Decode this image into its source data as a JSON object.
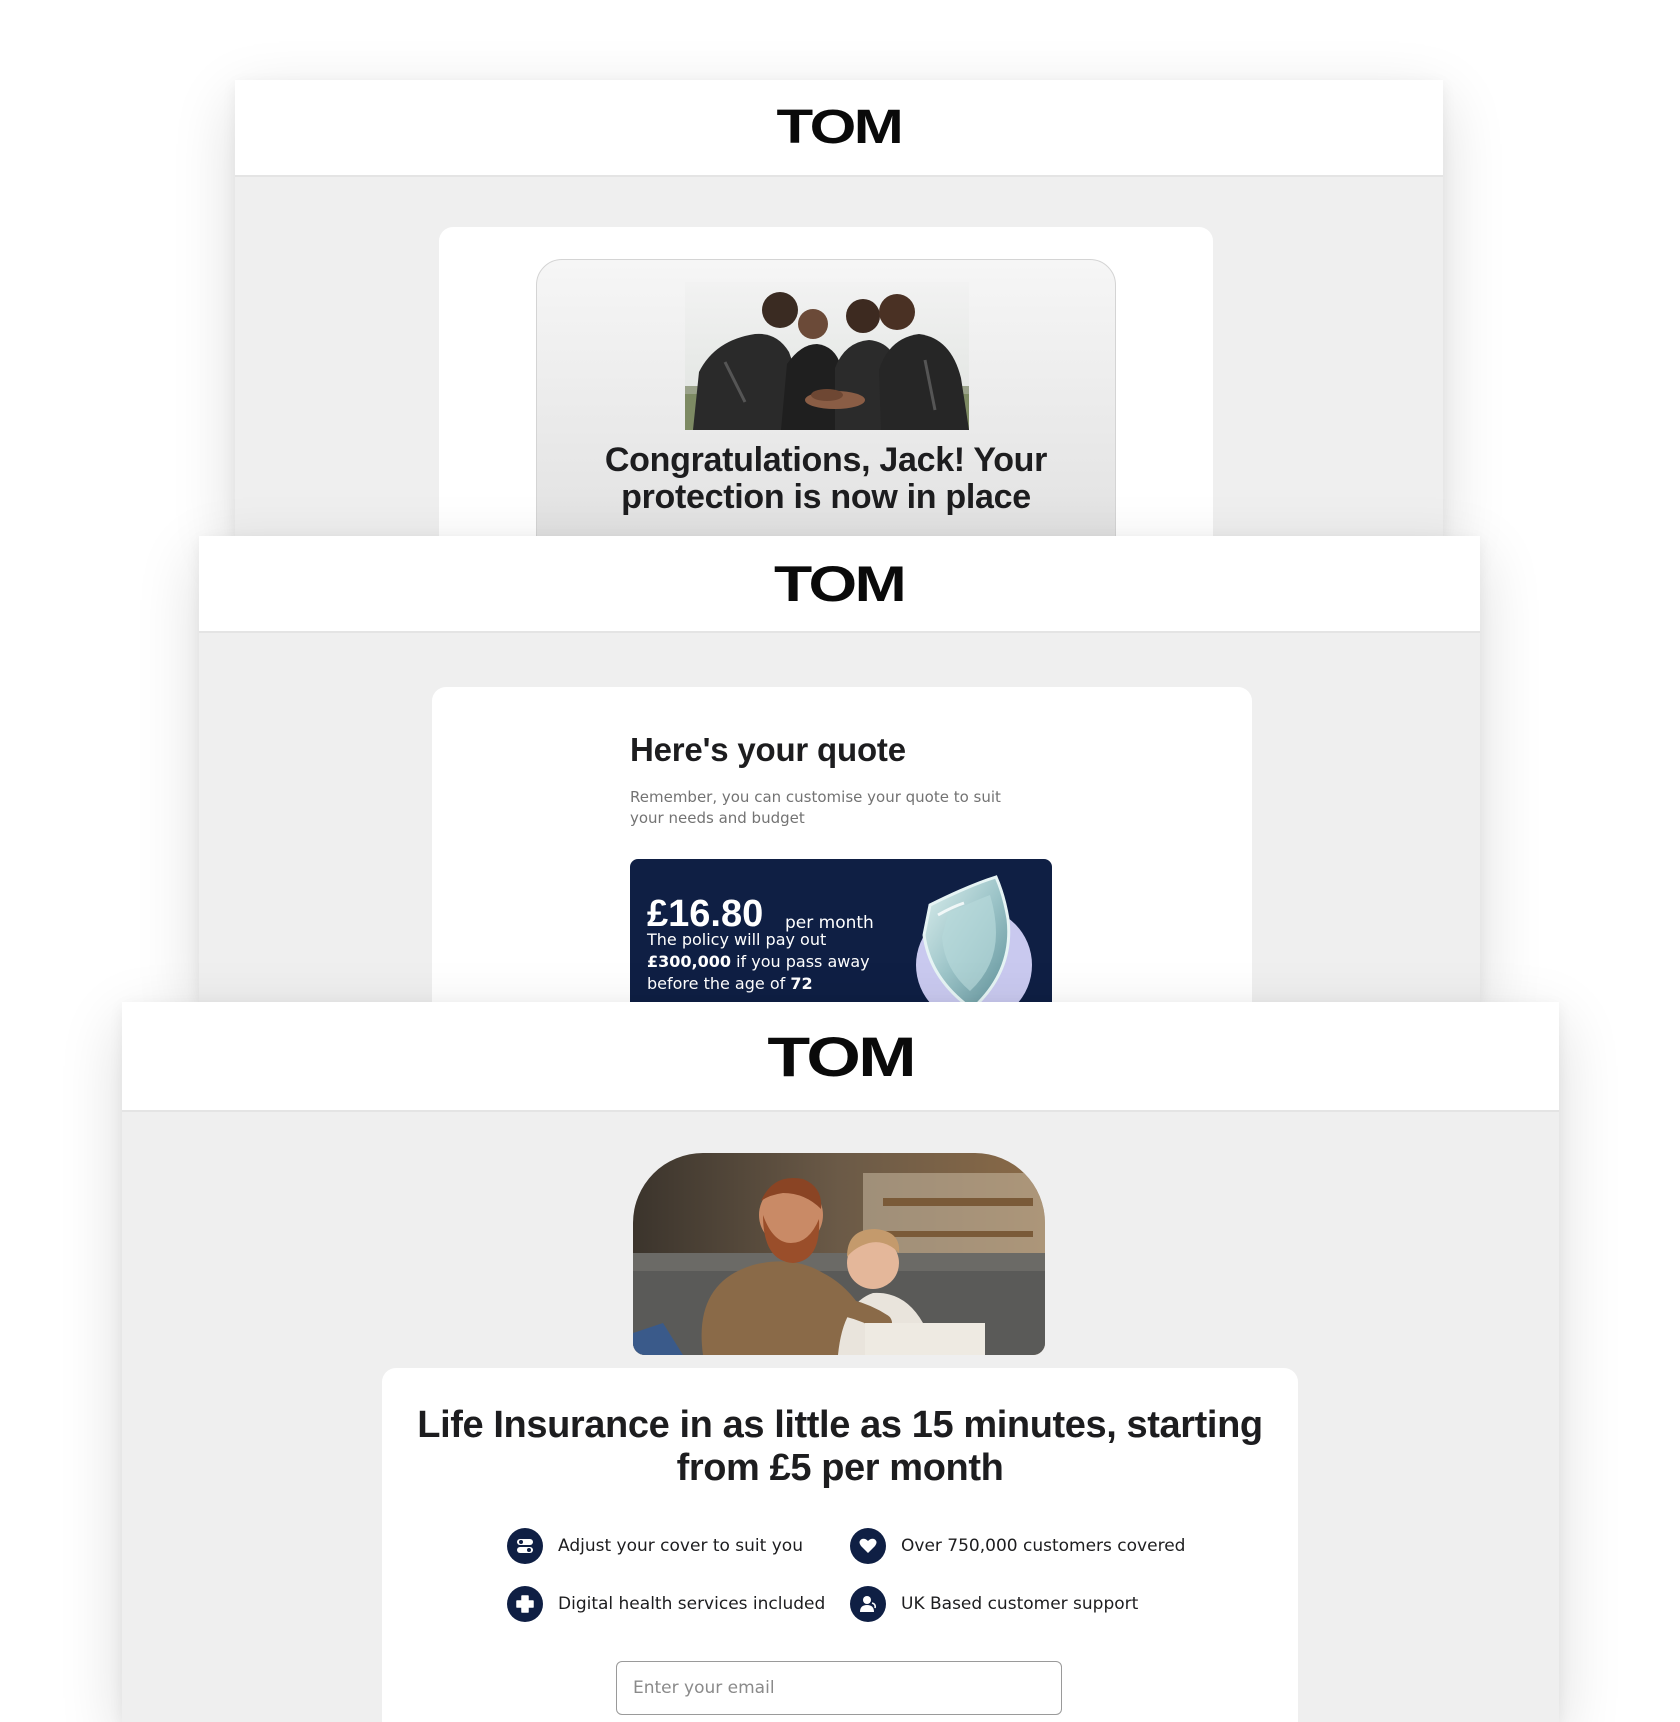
{
  "brand": {
    "logo_text": "TOM",
    "primary_color": "#0f1f44"
  },
  "email_confirmation": {
    "title": "Congratulations, Jack! Your protection is now in place"
  },
  "email_quote": {
    "title": "Here's your quote",
    "subtitle": "Remember, you can customise your quote to suit your needs and budget",
    "price": "£16.80",
    "price_period": "per month",
    "payout_prefix": "The policy will pay out ",
    "payout_amount": "£300,000",
    "payout_middle": " if you pass away before the age of ",
    "payout_age": "72"
  },
  "email_offer": {
    "title": "Life Insurance in as little as 15 minutes, starting from £5 per month",
    "features": [
      {
        "label": "Adjust your cover to suit you",
        "icon": "toggle-icon"
      },
      {
        "label": "Over 750,000 customers covered",
        "icon": "heart-icon"
      },
      {
        "label": "Digital health services included",
        "icon": "medical-cross-icon"
      },
      {
        "label": "UK Based customer support",
        "icon": "support-agent-icon"
      }
    ],
    "email_placeholder": "Enter your email"
  }
}
